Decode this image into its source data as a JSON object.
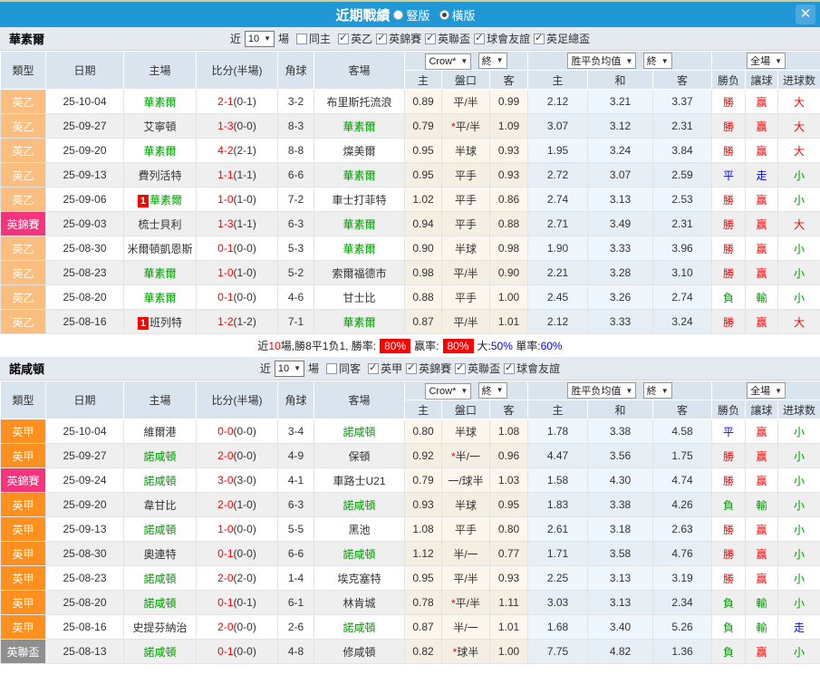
{
  "titlebar": {
    "title": "近期戰績",
    "radio_vertical": "豎版",
    "radio_horizontal": "橫版",
    "close_icon": "✕"
  },
  "header": {
    "cols": [
      "類型",
      "日期",
      "主場",
      "比分(半場)",
      "角球",
      "客場"
    ],
    "sub": [
      "主",
      "盤口",
      "客",
      "主",
      "和",
      "客",
      "勝负",
      "讓球",
      "进球数"
    ],
    "dd_crow": "Crow*",
    "dd_final1": "終",
    "dd_avg": "胜平负均值",
    "dd_final2": "終",
    "dd_full": "全場"
  },
  "colors": {
    "topbar": "#1F98D5",
    "league2": "#FBBE7E",
    "league1": "#FF8F1F",
    "trophy": "#F4347C",
    "efl_cup": "#8F8F8F",
    "win": "#FF0000",
    "draw": "#0000FF",
    "lose": "#009900"
  },
  "tables": [
    {
      "team": "華素爾",
      "filter": {
        "prefix": "近",
        "count": "10",
        "suffix": "場",
        "same_label": "同主",
        "same_checked": false,
        "leagues": [
          "英乙",
          "英錦賽",
          "英聯盃",
          "球會友誼",
          "英足總盃"
        ]
      },
      "rows": [
        {
          "lg": "英乙",
          "lgc": "l2",
          "date": "25-10-04",
          "hbadge": "",
          "home": "華素爾",
          "hfocus": true,
          "score": "2-1",
          "half": "(0-1)",
          "corner": "3-2",
          "away": "布里斯托流浪",
          "afocus": false,
          "o1": "0.89",
          "star": false,
          "hc": "平/半",
          "o2": "0.99",
          "e1": "2.12",
          "e2": "3.21",
          "e3": "3.37",
          "res": "勝",
          "resc": "red",
          "let": "赢",
          "letc": "red",
          "goal": "大",
          "goalc": "red"
        },
        {
          "lg": "英乙",
          "lgc": "l2",
          "date": "25-09-27",
          "hbadge": "",
          "home": "艾寧頓",
          "hfocus": false,
          "score": "1-3",
          "half": "(0-0)",
          "corner": "8-3",
          "away": "華素爾",
          "afocus": true,
          "o1": "0.79",
          "star": true,
          "hc": "平/半",
          "o2": "1.09",
          "e1": "3.07",
          "e2": "3.12",
          "e3": "2.31",
          "res": "勝",
          "resc": "red",
          "let": "赢",
          "letc": "red",
          "goal": "大",
          "goalc": "red"
        },
        {
          "lg": "英乙",
          "lgc": "l2",
          "date": "25-09-20",
          "hbadge": "",
          "home": "華素爾",
          "hfocus": true,
          "score": "4-2",
          "half": "(2-1)",
          "corner": "8-8",
          "away": "燦美爾",
          "afocus": false,
          "o1": "0.95",
          "star": false,
          "hc": "半球",
          "o2": "0.93",
          "e1": "1.95",
          "e2": "3.24",
          "e3": "3.84",
          "res": "勝",
          "resc": "red",
          "let": "赢",
          "letc": "red",
          "goal": "大",
          "goalc": "red"
        },
        {
          "lg": "英乙",
          "lgc": "l2",
          "date": "25-09-13",
          "hbadge": "",
          "home": "費列活特",
          "hfocus": false,
          "score": "1-1",
          "half": "(1-1)",
          "corner": "6-6",
          "away": "華素爾",
          "afocus": true,
          "o1": "0.95",
          "star": false,
          "hc": "平手",
          "o2": "0.93",
          "e1": "2.72",
          "e2": "3.07",
          "e3": "2.59",
          "res": "平",
          "resc": "blue",
          "let": "走",
          "letc": "blue",
          "goal": "小",
          "goalc": "green"
        },
        {
          "lg": "英乙",
          "lgc": "l2",
          "date": "25-09-06",
          "hbadge": "1",
          "home": "華素爾",
          "hfocus": true,
          "score": "1-0",
          "half": "(1-0)",
          "corner": "7-2",
          "away": "車士打菲特",
          "afocus": false,
          "o1": "1.02",
          "star": false,
          "hc": "平手",
          "o2": "0.86",
          "e1": "2.74",
          "e2": "3.13",
          "e3": "2.53",
          "res": "勝",
          "resc": "red",
          "let": "赢",
          "letc": "red",
          "goal": "小",
          "goalc": "green"
        },
        {
          "lg": "英錦賽",
          "lgc": "cup",
          "date": "25-09-03",
          "hbadge": "",
          "home": "梳士貝利",
          "hfocus": false,
          "score": "1-3",
          "half": "(1-1)",
          "corner": "6-3",
          "away": "華素爾",
          "afocus": true,
          "o1": "0.94",
          "star": false,
          "hc": "平手",
          "o2": "0.88",
          "e1": "2.71",
          "e2": "3.49",
          "e3": "2.31",
          "res": "勝",
          "resc": "red",
          "let": "赢",
          "letc": "red",
          "goal": "大",
          "goalc": "red"
        },
        {
          "lg": "英乙",
          "lgc": "l2",
          "date": "25-08-30",
          "hbadge": "",
          "home": "米爾頓凱恩斯",
          "hfocus": false,
          "score": "0-1",
          "half": "(0-0)",
          "corner": "5-3",
          "away": "華素爾",
          "afocus": true,
          "o1": "0.90",
          "star": false,
          "hc": "半球",
          "o2": "0.98",
          "e1": "1.90",
          "e2": "3.33",
          "e3": "3.96",
          "res": "勝",
          "resc": "red",
          "let": "赢",
          "letc": "red",
          "goal": "小",
          "goalc": "green"
        },
        {
          "lg": "英乙",
          "lgc": "l2",
          "date": "25-08-23",
          "hbadge": "",
          "home": "華素爾",
          "hfocus": true,
          "score": "1-0",
          "half": "(1-0)",
          "corner": "5-2",
          "away": "索爾福德市",
          "afocus": false,
          "o1": "0.98",
          "star": false,
          "hc": "平/半",
          "o2": "0.90",
          "e1": "2.21",
          "e2": "3.28",
          "e3": "3.10",
          "res": "勝",
          "resc": "red",
          "let": "赢",
          "letc": "red",
          "goal": "小",
          "goalc": "green"
        },
        {
          "lg": "英乙",
          "lgc": "l2",
          "date": "25-08-20",
          "hbadge": "",
          "home": "華素爾",
          "hfocus": true,
          "score": "0-1",
          "half": "(0-0)",
          "corner": "4-6",
          "away": "甘士比",
          "afocus": false,
          "o1": "0.88",
          "star": false,
          "hc": "平手",
          "o2": "1.00",
          "e1": "2.45",
          "e2": "3.26",
          "e3": "2.74",
          "res": "負",
          "resc": "green",
          "let": "輸",
          "letc": "green",
          "goal": "小",
          "goalc": "green"
        },
        {
          "lg": "英乙",
          "lgc": "l2",
          "date": "25-08-16",
          "hbadge": "1",
          "home": "班列特",
          "hfocus": false,
          "score": "1-2",
          "half": "(1-2)",
          "corner": "7-1",
          "away": "華素爾",
          "afocus": true,
          "o1": "0.87",
          "star": false,
          "hc": "平/半",
          "o2": "1.01",
          "e1": "2.12",
          "e2": "3.33",
          "e3": "3.24",
          "res": "勝",
          "resc": "red",
          "let": "赢",
          "letc": "red",
          "goal": "大",
          "goalc": "red"
        }
      ]
    },
    {
      "team": "諾咸頓",
      "filter": {
        "prefix": "近",
        "count": "10",
        "suffix": "場",
        "same_label": "同客",
        "same_checked": false,
        "leagues": [
          "英甲",
          "英錦賽",
          "英聯盃",
          "球會友誼"
        ]
      },
      "rows": [
        {
          "lg": "英甲",
          "lgc": "l1",
          "date": "25-10-04",
          "hbadge": "",
          "home": "維爾港",
          "hfocus": false,
          "score": "0-0",
          "half": "(0-0)",
          "corner": "3-4",
          "away": "諾咸頓",
          "afocus": true,
          "o1": "0.80",
          "star": false,
          "hc": "半球",
          "o2": "1.08",
          "e1": "1.78",
          "e2": "3.38",
          "e3": "4.58",
          "res": "平",
          "resc": "blue",
          "let": "赢",
          "letc": "red",
          "goal": "小",
          "goalc": "green"
        },
        {
          "lg": "英甲",
          "lgc": "l1",
          "date": "25-09-27",
          "hbadge": "",
          "home": "諾咸頓",
          "hfocus": true,
          "score": "2-0",
          "half": "(0-0)",
          "corner": "4-9",
          "away": "保頓",
          "afocus": false,
          "o1": "0.92",
          "star": true,
          "hc": "半/一",
          "o2": "0.96",
          "e1": "4.47",
          "e2": "3.56",
          "e3": "1.75",
          "res": "勝",
          "resc": "red",
          "let": "赢",
          "letc": "red",
          "goal": "小",
          "goalc": "green"
        },
        {
          "lg": "英錦賽",
          "lgc": "cup",
          "date": "25-09-24",
          "hbadge": "",
          "home": "諾咸頓",
          "hfocus": true,
          "score": "3-0",
          "half": "(3-0)",
          "corner": "4-1",
          "away": "車路士U21",
          "afocus": false,
          "o1": "0.79",
          "star": false,
          "hc": "一/球半",
          "o2": "1.03",
          "e1": "1.58",
          "e2": "4.30",
          "e3": "4.74",
          "res": "勝",
          "resc": "red",
          "let": "赢",
          "letc": "red",
          "goal": "小",
          "goalc": "green"
        },
        {
          "lg": "英甲",
          "lgc": "l1",
          "date": "25-09-20",
          "hbadge": "",
          "home": "韋甘比",
          "hfocus": false,
          "score": "2-0",
          "half": "(1-0)",
          "corner": "6-3",
          "away": "諾咸頓",
          "afocus": true,
          "o1": "0.93",
          "star": false,
          "hc": "半球",
          "o2": "0.95",
          "e1": "1.83",
          "e2": "3.38",
          "e3": "4.26",
          "res": "負",
          "resc": "green",
          "let": "輸",
          "letc": "green",
          "goal": "小",
          "goalc": "green"
        },
        {
          "lg": "英甲",
          "lgc": "l1",
          "date": "25-09-13",
          "hbadge": "",
          "home": "諾咸頓",
          "hfocus": true,
          "score": "1-0",
          "half": "(0-0)",
          "corner": "5-5",
          "away": "黑池",
          "afocus": false,
          "o1": "1.08",
          "star": false,
          "hc": "平手",
          "o2": "0.80",
          "e1": "2.61",
          "e2": "3.18",
          "e3": "2.63",
          "res": "勝",
          "resc": "red",
          "let": "赢",
          "letc": "red",
          "goal": "小",
          "goalc": "green"
        },
        {
          "lg": "英甲",
          "lgc": "l1",
          "date": "25-08-30",
          "hbadge": "",
          "home": "奧連特",
          "hfocus": false,
          "score": "0-1",
          "half": "(0-0)",
          "corner": "6-6",
          "away": "諾咸頓",
          "afocus": true,
          "o1": "1.12",
          "star": false,
          "hc": "半/一",
          "o2": "0.77",
          "e1": "1.71",
          "e2": "3.58",
          "e3": "4.76",
          "res": "勝",
          "resc": "red",
          "let": "赢",
          "letc": "red",
          "goal": "小",
          "goalc": "green"
        },
        {
          "lg": "英甲",
          "lgc": "l1",
          "date": "25-08-23",
          "hbadge": "",
          "home": "諾咸頓",
          "hfocus": true,
          "score": "2-0",
          "half": "(2-0)",
          "corner": "1-4",
          "away": "埃克塞特",
          "afocus": false,
          "o1": "0.95",
          "star": false,
          "hc": "平/半",
          "o2": "0.93",
          "e1": "2.25",
          "e2": "3.13",
          "e3": "3.19",
          "res": "勝",
          "resc": "red",
          "let": "赢",
          "letc": "red",
          "goal": "小",
          "goalc": "green"
        },
        {
          "lg": "英甲",
          "lgc": "l1",
          "date": "25-08-20",
          "hbadge": "",
          "home": "諾咸頓",
          "hfocus": true,
          "score": "0-1",
          "half": "(0-1)",
          "corner": "6-1",
          "away": "林肯城",
          "afocus": false,
          "o1": "0.78",
          "star": true,
          "hc": "平/半",
          "o2": "1.11",
          "e1": "3.03",
          "e2": "3.13",
          "e3": "2.34",
          "res": "負",
          "resc": "green",
          "let": "輸",
          "letc": "green",
          "goal": "小",
          "goalc": "green"
        },
        {
          "lg": "英甲",
          "lgc": "l1",
          "date": "25-08-16",
          "hbadge": "",
          "home": "史提芬納治",
          "hfocus": false,
          "score": "2-0",
          "half": "(0-0)",
          "corner": "2-6",
          "away": "諾咸頓",
          "afocus": true,
          "o1": "0.87",
          "star": false,
          "hc": "半/一",
          "o2": "1.01",
          "e1": "1.68",
          "e2": "3.40",
          "e3": "5.26",
          "res": "負",
          "resc": "green",
          "let": "輸",
          "letc": "green",
          "goal": "走",
          "goalc": "blue"
        },
        {
          "lg": "英聯盃",
          "lgc": "lcup",
          "date": "25-08-13",
          "hbadge": "",
          "home": "諾咸頓",
          "hfocus": true,
          "score": "0-1",
          "half": "(0-0)",
          "corner": "4-8",
          "away": "修咸頓",
          "afocus": false,
          "o1": "0.82",
          "star": true,
          "hc": "球半",
          "o2": "1.00",
          "e1": "7.75",
          "e2": "4.82",
          "e3": "1.36",
          "res": "負",
          "resc": "green",
          "let": "赢",
          "letc": "red",
          "goal": "小",
          "goalc": "green"
        }
      ]
    }
  ],
  "summary": {
    "parts": [
      {
        "t": "近",
        "s": "k"
      },
      {
        "t": "10",
        "s": "r"
      },
      {
        "t": "場,勝8平1负1, 勝率:",
        "s": "k"
      },
      {
        "t": "80%",
        "s": "box"
      },
      {
        "t": "赢率:",
        "s": "k"
      },
      {
        "t": "80%",
        "s": "box"
      },
      {
        "t": "大:",
        "s": "k"
      },
      {
        "t": "50%",
        "s": "b"
      },
      {
        "t": " 單率:",
        "s": "k"
      },
      {
        "t": "60%",
        "s": "b"
      }
    ]
  }
}
